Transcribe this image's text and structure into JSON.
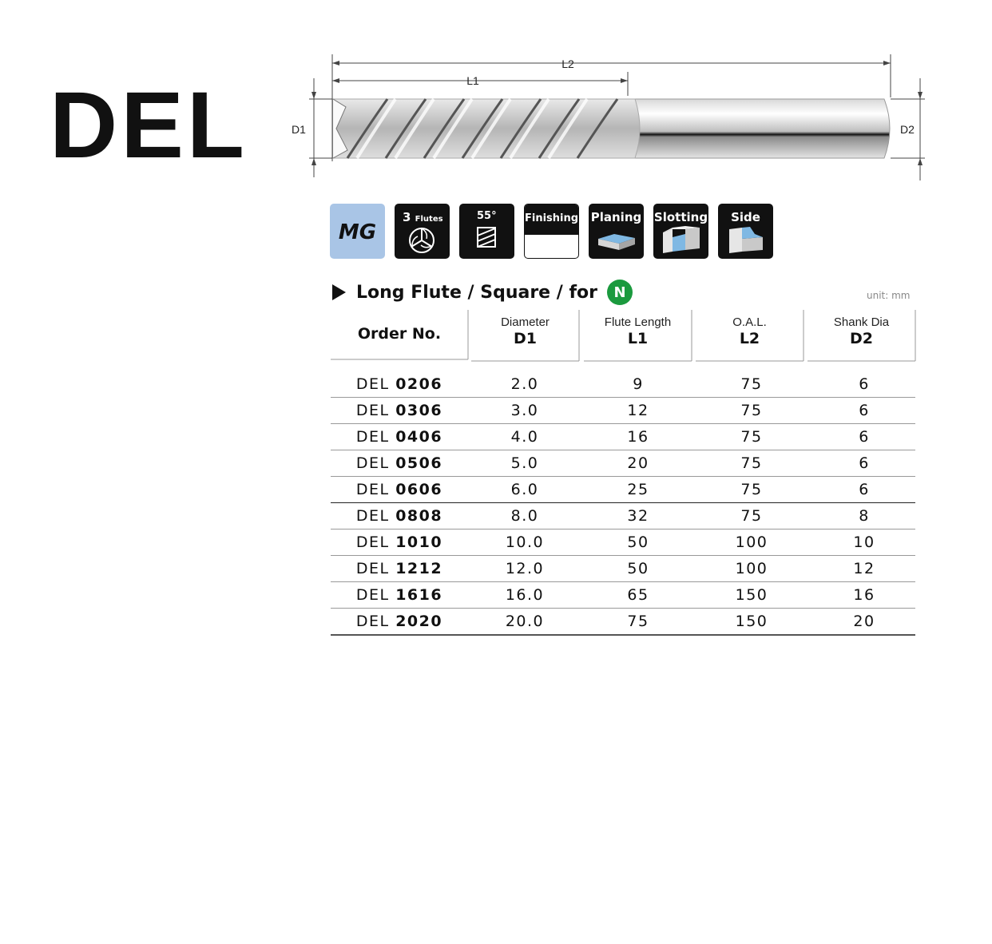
{
  "product_code": "DEL",
  "drawing": {
    "l2": "L2",
    "l1": "L1",
    "d1": "D1",
    "d2": "D2"
  },
  "icons": [
    {
      "name": "mg",
      "label": "MG"
    },
    {
      "name": "flutes",
      "count": "3",
      "label": "Flutes",
      "icon": "three-flute-icon"
    },
    {
      "name": "helix",
      "label": "55°",
      "icon": "helix-angle-icon"
    },
    {
      "name": "finishing",
      "label": "Finishing"
    },
    {
      "name": "planing",
      "label": "Planing",
      "icon": "planing-icon"
    },
    {
      "name": "slotting",
      "label": "Slotting",
      "icon": "slotting-icon"
    },
    {
      "name": "side",
      "label": "Side",
      "icon": "side-milling-icon"
    }
  ],
  "section": {
    "title": "Long Flute / Square / for",
    "material": "N",
    "material_color": "#1b9a3e",
    "unit": "unit: mm"
  },
  "table": {
    "headers": [
      {
        "sub": "",
        "sym": "Order No."
      },
      {
        "sub": "Diameter",
        "sym": "D1"
      },
      {
        "sub": "Flute Length",
        "sym": "L1"
      },
      {
        "sub": "O.A.L.",
        "sym": "L2"
      },
      {
        "sub": "Shank Dia",
        "sym": "D2"
      }
    ],
    "rows": [
      {
        "prefix": "DEL",
        "code": "0206",
        "d1": "2.0",
        "l1": "9",
        "l2": "75",
        "d2": "6"
      },
      {
        "prefix": "DEL",
        "code": "0306",
        "d1": "3.0",
        "l1": "12",
        "l2": "75",
        "d2": "6"
      },
      {
        "prefix": "DEL",
        "code": "0406",
        "d1": "4.0",
        "l1": "16",
        "l2": "75",
        "d2": "6"
      },
      {
        "prefix": "DEL",
        "code": "0506",
        "d1": "5.0",
        "l1": "20",
        "l2": "75",
        "d2": "6"
      },
      {
        "prefix": "DEL",
        "code": "0606",
        "d1": "6.0",
        "l1": "25",
        "l2": "75",
        "d2": "6"
      },
      {
        "prefix": "DEL",
        "code": "0808",
        "d1": "8.0",
        "l1": "32",
        "l2": "75",
        "d2": "8"
      },
      {
        "prefix": "DEL",
        "code": "1010",
        "d1": "10.0",
        "l1": "50",
        "l2": "100",
        "d2": "10"
      },
      {
        "prefix": "DEL",
        "code": "1212",
        "d1": "12.0",
        "l1": "50",
        "l2": "100",
        "d2": "12"
      },
      {
        "prefix": "DEL",
        "code": "1616",
        "d1": "16.0",
        "l1": "65",
        "l2": "150",
        "d2": "16"
      },
      {
        "prefix": "DEL",
        "code": "2020",
        "d1": "20.0",
        "l1": "75",
        "l2": "150",
        "d2": "20"
      }
    ]
  }
}
